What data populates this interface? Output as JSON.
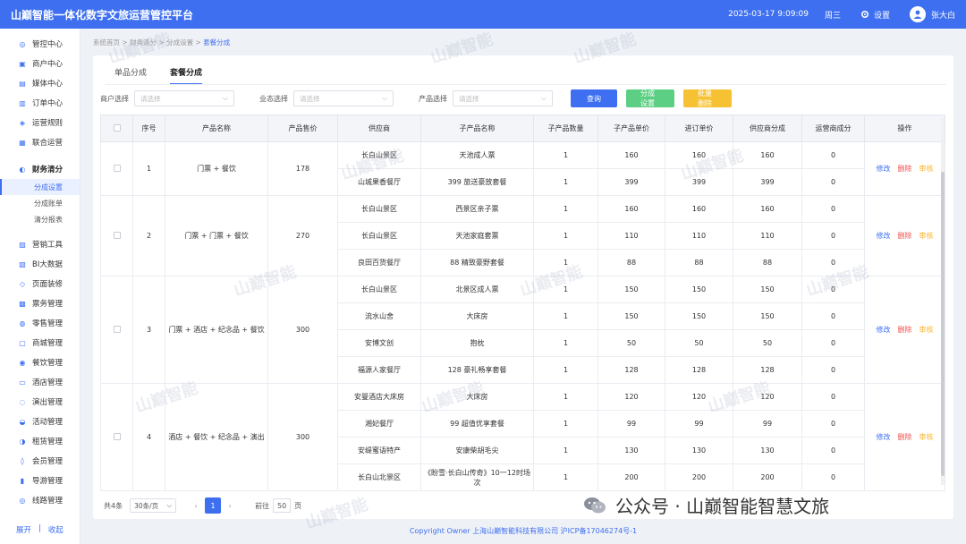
{
  "app": {
    "title": "山巅智能一体化数字文旅运营管控平台",
    "datetime": "2025-03-17 9:09:09",
    "weekday": "周三",
    "settings_label": "设置",
    "user": "张大白"
  },
  "sidebar": {
    "items": [
      {
        "label": "管控中心",
        "icon": "monitor-icon"
      },
      {
        "label": "商户中心",
        "icon": "shop-icon"
      },
      {
        "label": "媒体中心",
        "icon": "media-icon"
      },
      {
        "label": "订单中心",
        "icon": "order-icon"
      },
      {
        "label": "运营规则",
        "icon": "rule-icon"
      },
      {
        "label": "联合运营",
        "icon": "joint-icon"
      }
    ],
    "group": {
      "label": "财务清分",
      "subs": [
        "分成设置",
        "分成账单",
        "清分报表"
      ]
    },
    "items2": [
      {
        "label": "营销工具"
      },
      {
        "label": "BI大数据"
      },
      {
        "label": "页面装修"
      },
      {
        "label": "票务管理"
      },
      {
        "label": "零售管理"
      },
      {
        "label": "商城管理"
      },
      {
        "label": "餐饮管理"
      },
      {
        "label": "酒店管理"
      },
      {
        "label": "演出管理"
      },
      {
        "label": "活动管理"
      },
      {
        "label": "租赁管理"
      },
      {
        "label": "会员管理"
      },
      {
        "label": "导游管理"
      },
      {
        "label": "线路管理"
      }
    ],
    "expand": "展开",
    "collapse": "收起"
  },
  "breadcrumb": [
    "系统首页",
    "财务清分",
    "分成设置",
    "套餐分成"
  ],
  "tabs": [
    "单品分成",
    "套餐分成"
  ],
  "filters": {
    "merchant_label": "商户选择",
    "merchant_placeholder": "请选择",
    "business_label": "业态选择",
    "business_placeholder": "请选择",
    "product_label": "产品选择",
    "product_placeholder": "请选择",
    "query": "查询",
    "set": "分成设置",
    "batch_delete": "批量删除"
  },
  "table": {
    "headers": [
      "序号",
      "产品名称",
      "产品售价",
      "供应商",
      "子产品名称",
      "子产品数量",
      "子产品单价",
      "进订单价",
      "供应商分成",
      "运营商成分",
      "操作"
    ],
    "ops": {
      "edit": "修改",
      "delete": "删除",
      "audit": "审核"
    },
    "groups": [
      {
        "no": "1",
        "name": "门票 + 餐饮",
        "price": "178",
        "rows": [
          [
            "长白山景区",
            "天池成人票",
            "1",
            "160",
            "160",
            "160",
            "0"
          ],
          [
            "山城果香餐厅",
            "399 旅送豪放套餐",
            "1",
            "399",
            "399",
            "399",
            "0"
          ]
        ]
      },
      {
        "no": "2",
        "name": "门票 + 门票 + 餐饮",
        "price": "270",
        "rows": [
          [
            "长白山景区",
            "西景区亲子票",
            "1",
            "160",
            "160",
            "160",
            "0"
          ],
          [
            "长白山景区",
            "天池家庭套票",
            "1",
            "110",
            "110",
            "110",
            "0"
          ],
          [
            "良田百货餐厅",
            "88 精致豪野套餐",
            "1",
            "88",
            "88",
            "88",
            "0"
          ]
        ]
      },
      {
        "no": "3",
        "name": "门票 + 酒店 + 纪念品 + 餐饮",
        "price": "300",
        "rows": [
          [
            "长白山景区",
            "北景区成人票",
            "1",
            "150",
            "150",
            "150",
            "0"
          ],
          [
            "流水山舍",
            "大床房",
            "1",
            "150",
            "150",
            "150",
            "0"
          ],
          [
            "安博文创",
            "抱枕",
            "1",
            "50",
            "50",
            "50",
            "0"
          ],
          [
            "福源人家餐厅",
            "128 豪礼畅享套餐",
            "1",
            "128",
            "128",
            "128",
            "0"
          ]
        ]
      },
      {
        "no": "4",
        "name": "酒店 + 餐饮 + 纪念品 + 演出",
        "price": "300",
        "rows": [
          [
            "安曼酒店大床房",
            "大床房",
            "1",
            "120",
            "120",
            "120",
            "0"
          ],
          [
            "湘妃餐厅",
            "99 超值优享套餐",
            "1",
            "99",
            "99",
            "99",
            "0"
          ],
          [
            "安缇蜜语特产",
            "安康柴胡毛尖",
            "1",
            "130",
            "130",
            "130",
            "0"
          ],
          [
            "长白山北景区",
            "《盼雪·长白山传奇》10一12时场次",
            "1",
            "200",
            "200",
            "200",
            "0"
          ]
        ]
      }
    ]
  },
  "pager": {
    "total": "共4条",
    "size": "30条/页",
    "page": "1",
    "goto": "前往",
    "goto_val": "50",
    "unit": "页"
  },
  "footer": "Copyright Owner 上海山巅智能科技有限公司 沪ICP备17046274号-1",
  "watermark": "山巅智能",
  "wechat": "公众号 · 山巅智能智慧文旅"
}
